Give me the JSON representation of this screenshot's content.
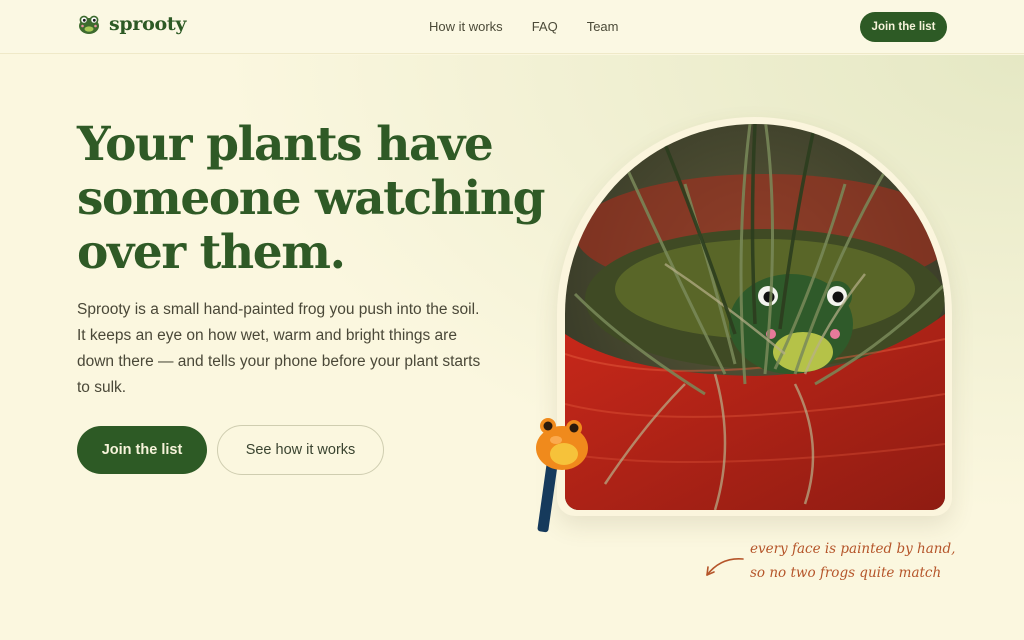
{
  "brand": {
    "name": "sprooty",
    "logo_icon": "frog-face-icon"
  },
  "nav": {
    "items": [
      {
        "label": "How it works"
      },
      {
        "label": "FAQ"
      },
      {
        "label": "Team"
      }
    ],
    "cta_label": "Join the list"
  },
  "hero": {
    "headline_lines": [
      "Your plants have",
      "someone watching",
      "over them."
    ],
    "lede_lines": [
      "Sprooty is a small hand-painted frog you push into the soil.",
      "It keeps an eye on how wet, warm and bright things are",
      "down there — and tells your phone before your plant starts",
      "to sulk."
    ],
    "primary_cta": "Join the list",
    "secondary_cta": "See how it works"
  },
  "photo_note": {
    "lines": [
      "every face is painted by hand,",
      "so no two frogs quite match"
    ]
  },
  "colors": {
    "brand_green": "#2d5a25",
    "background": "#fbf7df",
    "accent_rust": "#b5552a"
  }
}
